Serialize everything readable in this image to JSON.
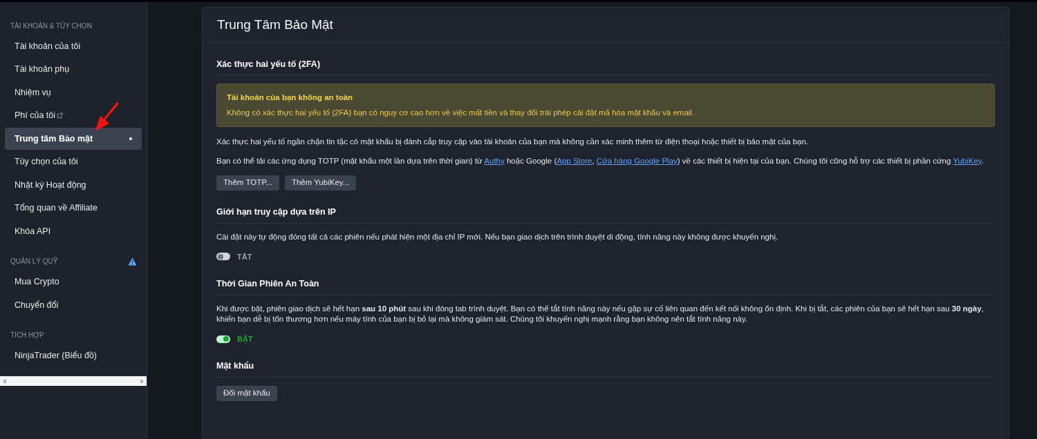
{
  "sidebar": {
    "sections": [
      {
        "heading": "TÀI KHOẢN & TÙY CHỌN",
        "warning": false,
        "items": [
          {
            "label": "Tài khoản của tôi",
            "selected": false,
            "external": false
          },
          {
            "label": "Tài khoản phụ",
            "selected": false,
            "external": false
          },
          {
            "label": "Nhiệm vụ",
            "selected": false,
            "external": false
          },
          {
            "label": "Phí của tôi",
            "selected": false,
            "external": true
          },
          {
            "label": "Trung tâm Bảo mật",
            "selected": true,
            "external": false
          },
          {
            "label": "Tùy chọn của tôi",
            "selected": false,
            "external": false
          },
          {
            "label": "Nhật ký Hoạt động",
            "selected": false,
            "external": false
          },
          {
            "label": "Tổng quan về Affiliate",
            "selected": false,
            "external": false
          },
          {
            "label": "Khóa API",
            "selected": false,
            "external": false
          }
        ]
      },
      {
        "heading": "QUẢN LÝ QUỸ",
        "warning": true,
        "items": [
          {
            "label": "Mua Crypto",
            "selected": false,
            "external": false
          },
          {
            "label": "Chuyển đổi",
            "selected": false,
            "external": false
          }
        ]
      },
      {
        "heading": "TÍCH HỢP",
        "warning": false,
        "items": [
          {
            "label": "NinjaTrader (Biểu đồ)",
            "selected": false,
            "external": false
          }
        ]
      }
    ]
  },
  "main": {
    "title": "Trung Tâm Bảo Mật",
    "sections": [
      {
        "heading": "Xác thực hai yếu tố (2FA)",
        "alert": {
          "title": "Tài khoản của bạn không an toàn",
          "text": "Không có xác thực hai yếu tố (2FA) bạn có nguy cơ cao hơn về việc mất tiền và thay đổi trái phép cài đặt mã hóa mật khẩu và email."
        },
        "paragraphs": [
          [
            {
              "text": "Xác thực hai yếu tố ngăn chặn tin tặc có mật khẩu bị đánh cắp truy cập vào tài khoản của bạn mà không cần xác minh thêm từ điện thoại hoặc thiết bị bảo mật của bạn.",
              "link": false
            }
          ],
          [
            {
              "text": "Bạn có thể tải các ứng dụng TOTP (mật khẩu một lần dựa trên thời gian) từ ",
              "link": false
            },
            {
              "text": "Authy",
              "link": true
            },
            {
              "text": " hoặc Google (",
              "link": false
            },
            {
              "text": "App Store",
              "link": true
            },
            {
              "text": ", ",
              "link": false
            },
            {
              "text": "Cửa hàng Google Play",
              "link": true
            },
            {
              "text": ") về các thiết bị hiện tại của bạn. Chúng tôi cũng hỗ trợ các thiết bị phần cứng ",
              "link": false
            },
            {
              "text": "YubiKey",
              "link": true
            },
            {
              "text": ".",
              "link": false
            }
          ]
        ],
        "buttons": [
          "Thêm TOTP...",
          "Thêm YubiKey..."
        ]
      },
      {
        "heading": "Giới hạn truy cập dựa trên IP",
        "paragraphs": [
          [
            {
              "text": "Cài đặt này tự động đóng tất cả các phiên nếu phát hiện một địa chỉ IP mới. Nếu bạn giao dịch trên trình duyệt di động, tính năng này không được khuyến nghị.",
              "link": false
            }
          ]
        ],
        "toggle": {
          "on": false,
          "label": "TẮT"
        }
      },
      {
        "heading": "Thời Gian Phiên An Toàn",
        "paragraphs": [
          [
            {
              "text": "Khi được bật, phiên giao dịch sẽ hết hạn **sau 10 phút** sau khi đóng tab trình duyệt. Bạn có thể tắt tính năng này nếu gặp sự cố liên quan đến kết nối không ổn định. Khi bị tắt, các phiên của bạn sẽ hết hạn sau **30 ngày**, khiến bạn dễ bị tổn thương hơn nếu máy tính của bạn bị bỏ lại mà không giám sát. Chúng tôi khuyến nghị mạnh rằng bạn không nên tắt tính năng này.",
              "link": false
            }
          ]
        ],
        "toggle": {
          "on": true,
          "label": "BẬT"
        }
      },
      {
        "heading": "Mật khẩu",
        "buttons": [
          "Đổi mật khẩu"
        ]
      }
    ]
  }
}
